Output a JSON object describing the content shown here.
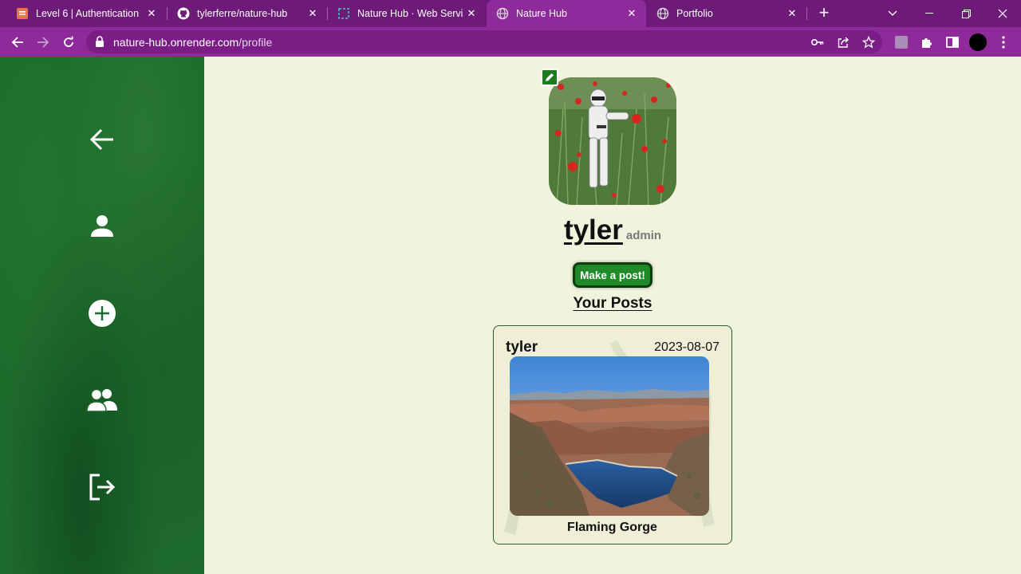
{
  "browser": {
    "tabs": [
      {
        "label": "Level 6 | Authentication",
        "icon": "doc-tab-icon",
        "active": false
      },
      {
        "label": "tylerferre/nature-hub",
        "icon": "github-icon",
        "active": false
      },
      {
        "label": "Nature Hub · Web Service",
        "icon": "render-icon",
        "active": false
      },
      {
        "label": "Nature Hub",
        "icon": "globe-icon",
        "active": true
      },
      {
        "label": "Portfolio",
        "icon": "globe-icon",
        "active": false
      }
    ],
    "url_host": "nature-hub.onrender.com",
    "url_path": "/profile",
    "colors": {
      "frame": "#6e1a78",
      "toolbar": "#8e2a9a"
    }
  },
  "sidebar": {
    "items": [
      {
        "icon": "back-arrow-icon"
      },
      {
        "icon": "profile-icon"
      },
      {
        "icon": "add-circle-icon"
      },
      {
        "icon": "users-icon"
      },
      {
        "icon": "logout-icon"
      }
    ],
    "color": "#1d6b2c"
  },
  "profile": {
    "username": "tyler",
    "role": "admin",
    "make_post_label": "Make a post!",
    "posts_heading": "Your Posts"
  },
  "posts": [
    {
      "author": "tyler",
      "date": "2023-08-07",
      "caption": "Flaming Gorge"
    }
  ],
  "colors": {
    "page_bg": "#f2f3dc",
    "accent": "#1f8a27"
  }
}
